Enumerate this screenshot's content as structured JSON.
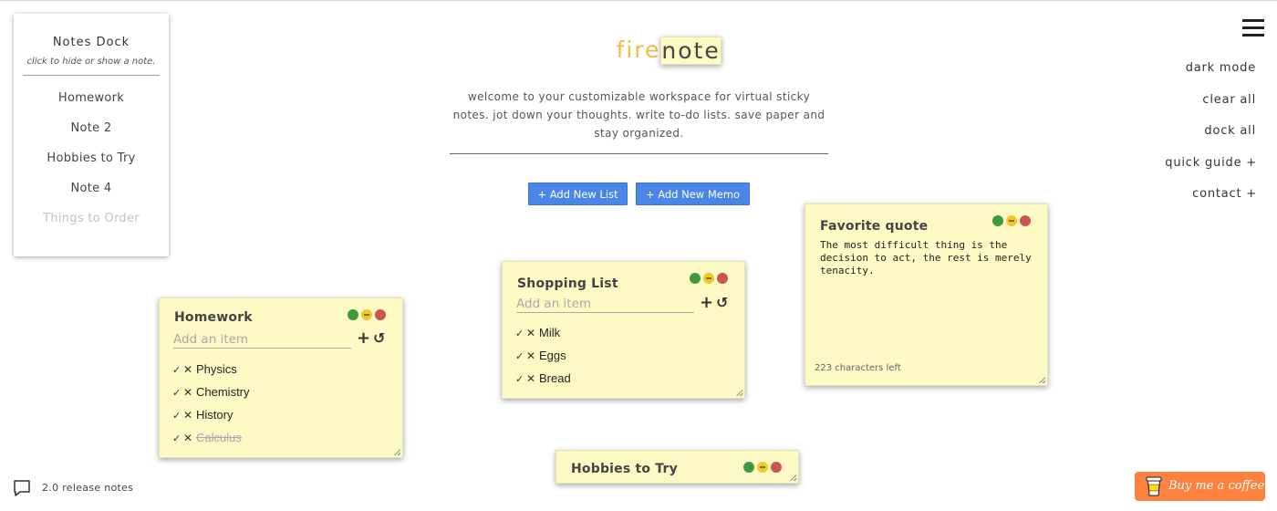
{
  "app": {
    "brand_part1": "fire",
    "brand_part2": "note",
    "tagline": "welcome to your customizable workspace for virtual sticky notes. jot down your thoughts. write to-do lists. save paper and stay organized."
  },
  "dock": {
    "title": "Notes Dock",
    "subtitle": "click to hide or show a note.",
    "items": [
      {
        "label": "Homework",
        "hidden": false
      },
      {
        "label": "Note 2",
        "hidden": false
      },
      {
        "label": "Hobbies to Try",
        "hidden": false
      },
      {
        "label": "Note 4",
        "hidden": false
      },
      {
        "label": "Things to Order",
        "hidden": true
      }
    ]
  },
  "toolbar": {
    "add_list_label": "+ Add New List",
    "add_memo_label": "+ Add New Memo"
  },
  "menu": {
    "icon": "hamburger-icon",
    "items": [
      "dark mode",
      "clear all",
      "dock all",
      "quick guide +",
      "contact +"
    ]
  },
  "notes": {
    "homework": {
      "title": "Homework",
      "placeholder": "Add an item",
      "items": [
        {
          "text": "Physics",
          "done": false
        },
        {
          "text": "Chemistry",
          "done": false
        },
        {
          "text": "History",
          "done": false
        },
        {
          "text": "Calculus",
          "done": true
        }
      ]
    },
    "shopping": {
      "title": "Shopping List",
      "placeholder": "Add an item",
      "items": [
        {
          "text": "Milk",
          "done": false
        },
        {
          "text": "Eggs",
          "done": false
        },
        {
          "text": "Bread",
          "done": false
        }
      ]
    },
    "quote": {
      "title": "Favorite quote",
      "text": "The most difficult thing is the decision to act, the rest is merely tenacity.",
      "chars_left": "223 characters left"
    },
    "hobbies": {
      "title": "Hobbies to Try"
    }
  },
  "footer": {
    "release_notes": "2.0 release notes",
    "coffee_label": "Buy me a coffee"
  },
  "colors": {
    "accent": "#f0b94a",
    "button": "#4a86e8",
    "note_bg": "#fcf9c5",
    "light_green": "#3f9a3b",
    "light_yellow": "#efc82a",
    "light_red": "#cc5454",
    "coffee": "#ff813f"
  }
}
